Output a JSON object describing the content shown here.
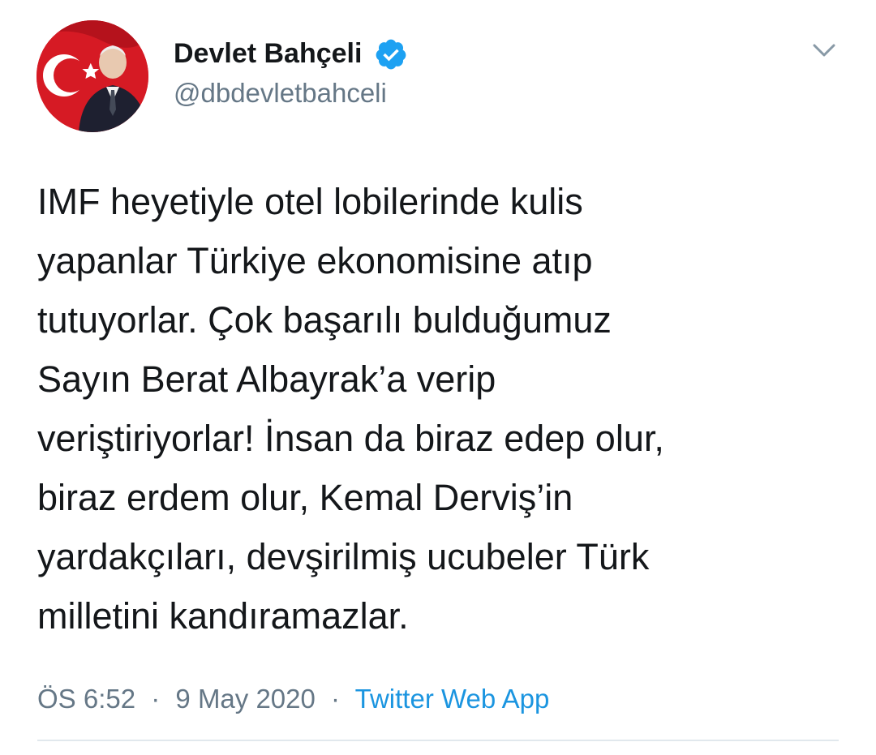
{
  "author": {
    "display_name": "Devlet Bahçeli",
    "handle": "@dbdevletbahceli",
    "verified": true,
    "verified_color": "#1da1f2"
  },
  "tweet": {
    "lines": [
      "IMF heyetiyle otel lobilerinde kulis",
      "yapanlar Türkiye ekonomisine atıp",
      "tutuyorlar. Çok başarılı bulduğumuz",
      "Sayın Berat Albayrak’a verip",
      "veriştiriyorlar! İnsan da biraz edep olur,",
      "biraz erdem olur, Kemal Derviş’in",
      "yardakçıları, devşirilmiş ucubeler Türk",
      "milletini kandıramazlar."
    ]
  },
  "meta": {
    "time": "ÖS 6:52",
    "separator": "·",
    "date": "9 May 2020",
    "source": "Twitter Web App"
  },
  "icons": {
    "verified": "verified-badge-icon",
    "menu": "chevron-down-icon"
  },
  "colors": {
    "text": "#14171a",
    "secondary": "#657786",
    "link": "#1b95e0",
    "divider": "#e1e8ed"
  }
}
